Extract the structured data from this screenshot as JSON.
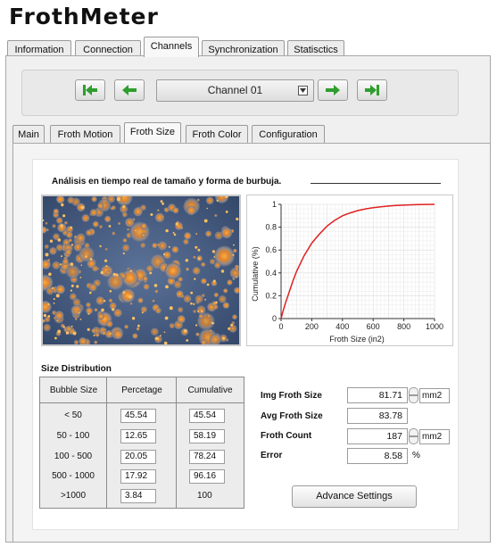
{
  "app_title": "FrothMeter",
  "top_tabs": [
    {
      "label": "Information",
      "active": false
    },
    {
      "label": "Connection",
      "active": false
    },
    {
      "label": "Channels",
      "active": true
    },
    {
      "label": "Synchronization",
      "active": false
    },
    {
      "label": "Statisctics",
      "active": false
    }
  ],
  "channel_nav": {
    "selected_channel": "Channel 01",
    "buttons": [
      "first-icon",
      "prev-icon",
      "next-icon",
      "last-icon"
    ],
    "button_color": "#2e9e2e"
  },
  "sub_tabs": [
    {
      "label": "Main",
      "active": false
    },
    {
      "label": "Froth Motion",
      "active": false
    },
    {
      "label": "Froth Size",
      "active": true
    },
    {
      "label": "Froth Color",
      "active": false
    },
    {
      "label": "Configuration",
      "active": false
    }
  ],
  "analysis_title": "Análisis en tiempo real de tamaño y forma de burbuja.",
  "chart_data": {
    "type": "line",
    "title": "",
    "xlabel": "Froth Size (in2)",
    "ylabel": "Cumulative (%)",
    "xlim": [
      0,
      1000
    ],
    "ylim": [
      0,
      1
    ],
    "grid": true,
    "xticks": [
      "0",
      "200",
      "400",
      "600",
      "800",
      "1000"
    ],
    "yticks": [
      "0",
      "0.2",
      "0.4",
      "0.6",
      "0.8",
      "1"
    ],
    "line_color": "#e02020",
    "x": [
      0,
      10,
      25,
      50,
      75,
      100,
      150,
      200,
      250,
      300,
      350,
      400,
      450,
      500,
      550,
      600,
      650,
      700,
      750,
      800,
      850,
      900,
      950,
      1000
    ],
    "y": [
      0,
      0.05,
      0.12,
      0.22,
      0.32,
      0.41,
      0.55,
      0.66,
      0.74,
      0.81,
      0.86,
      0.9,
      0.925,
      0.945,
      0.96,
      0.97,
      0.978,
      0.985,
      0.99,
      0.993,
      0.996,
      0.998,
      0.999,
      1.0
    ]
  },
  "size_distribution": {
    "title": "Size Distribution",
    "headers": [
      "Bubble Size",
      "Percetage",
      "Cumulative"
    ],
    "rows": [
      {
        "range": "< 50",
        "percentage": "45.54",
        "cumulative": "45.54"
      },
      {
        "range": "50 - 100",
        "percentage": "12.65",
        "cumulative": "58.19"
      },
      {
        "range": "100 - 500",
        "percentage": "20.05",
        "cumulative": "78.24"
      },
      {
        "range": "500 - 1000",
        "percentage": "17.92",
        "cumulative": "96.16"
      },
      {
        "range": ">1000",
        "percentage": "3.84",
        "cumulative": "100"
      }
    ]
  },
  "stats": {
    "img_froth_size": {
      "label": "Img Froth Size",
      "value": "81.71",
      "unit": "mm2"
    },
    "avg_froth_size": {
      "label": "Avg Froth Size",
      "value": "83.78"
    },
    "froth_count": {
      "label": "Froth Count",
      "value": "187",
      "unit": "mm2"
    },
    "error": {
      "label": "Error",
      "value": "8.58",
      "unit": "%"
    }
  },
  "advance_settings_label": "Advance Settings"
}
